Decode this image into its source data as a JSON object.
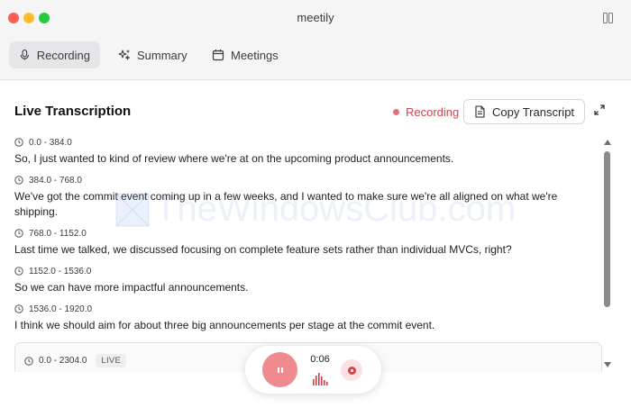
{
  "window": {
    "title": "meetily"
  },
  "tabs": [
    {
      "label": "Recording",
      "icon": "microphone-icon",
      "active": true
    },
    {
      "label": "Summary",
      "icon": "sparkles-icon",
      "active": false
    },
    {
      "label": "Meetings",
      "icon": "calendar-icon",
      "active": false
    }
  ],
  "header": {
    "title": "Live Transcription",
    "status_label": "Recording",
    "copy_label": "Copy Transcript"
  },
  "transcript": [
    {
      "time": "0.0 - 384.0",
      "text": "So, I just wanted to kind of review where we're at on the upcoming product announcements."
    },
    {
      "time": "384.0 - 768.0",
      "text": "We've got the commit event coming up in a few weeks, and I wanted to make sure we're all aligned on what we're shipping."
    },
    {
      "time": "768.0 - 1152.0",
      "text": "Last time we talked, we discussed focusing on complete feature sets rather than individual MVCs, right?"
    },
    {
      "time": "1152.0 - 1536.0",
      "text": "So we can have more impactful announcements."
    },
    {
      "time": "1536.0 - 1920.0",
      "text": "I think we should aim for about three big announcements per stage at the commit event."
    }
  ],
  "live_entry": {
    "time": "0.0 - 2304.0",
    "badge": "LIVE"
  },
  "controls": {
    "timer": "0:06"
  },
  "watermark": {
    "text": "TheWindowsClub.com"
  },
  "colors": {
    "recording_accent": "#c9484f",
    "pause_button": "#ef8a8f",
    "stop_button_bg": "#fbe1e3"
  }
}
